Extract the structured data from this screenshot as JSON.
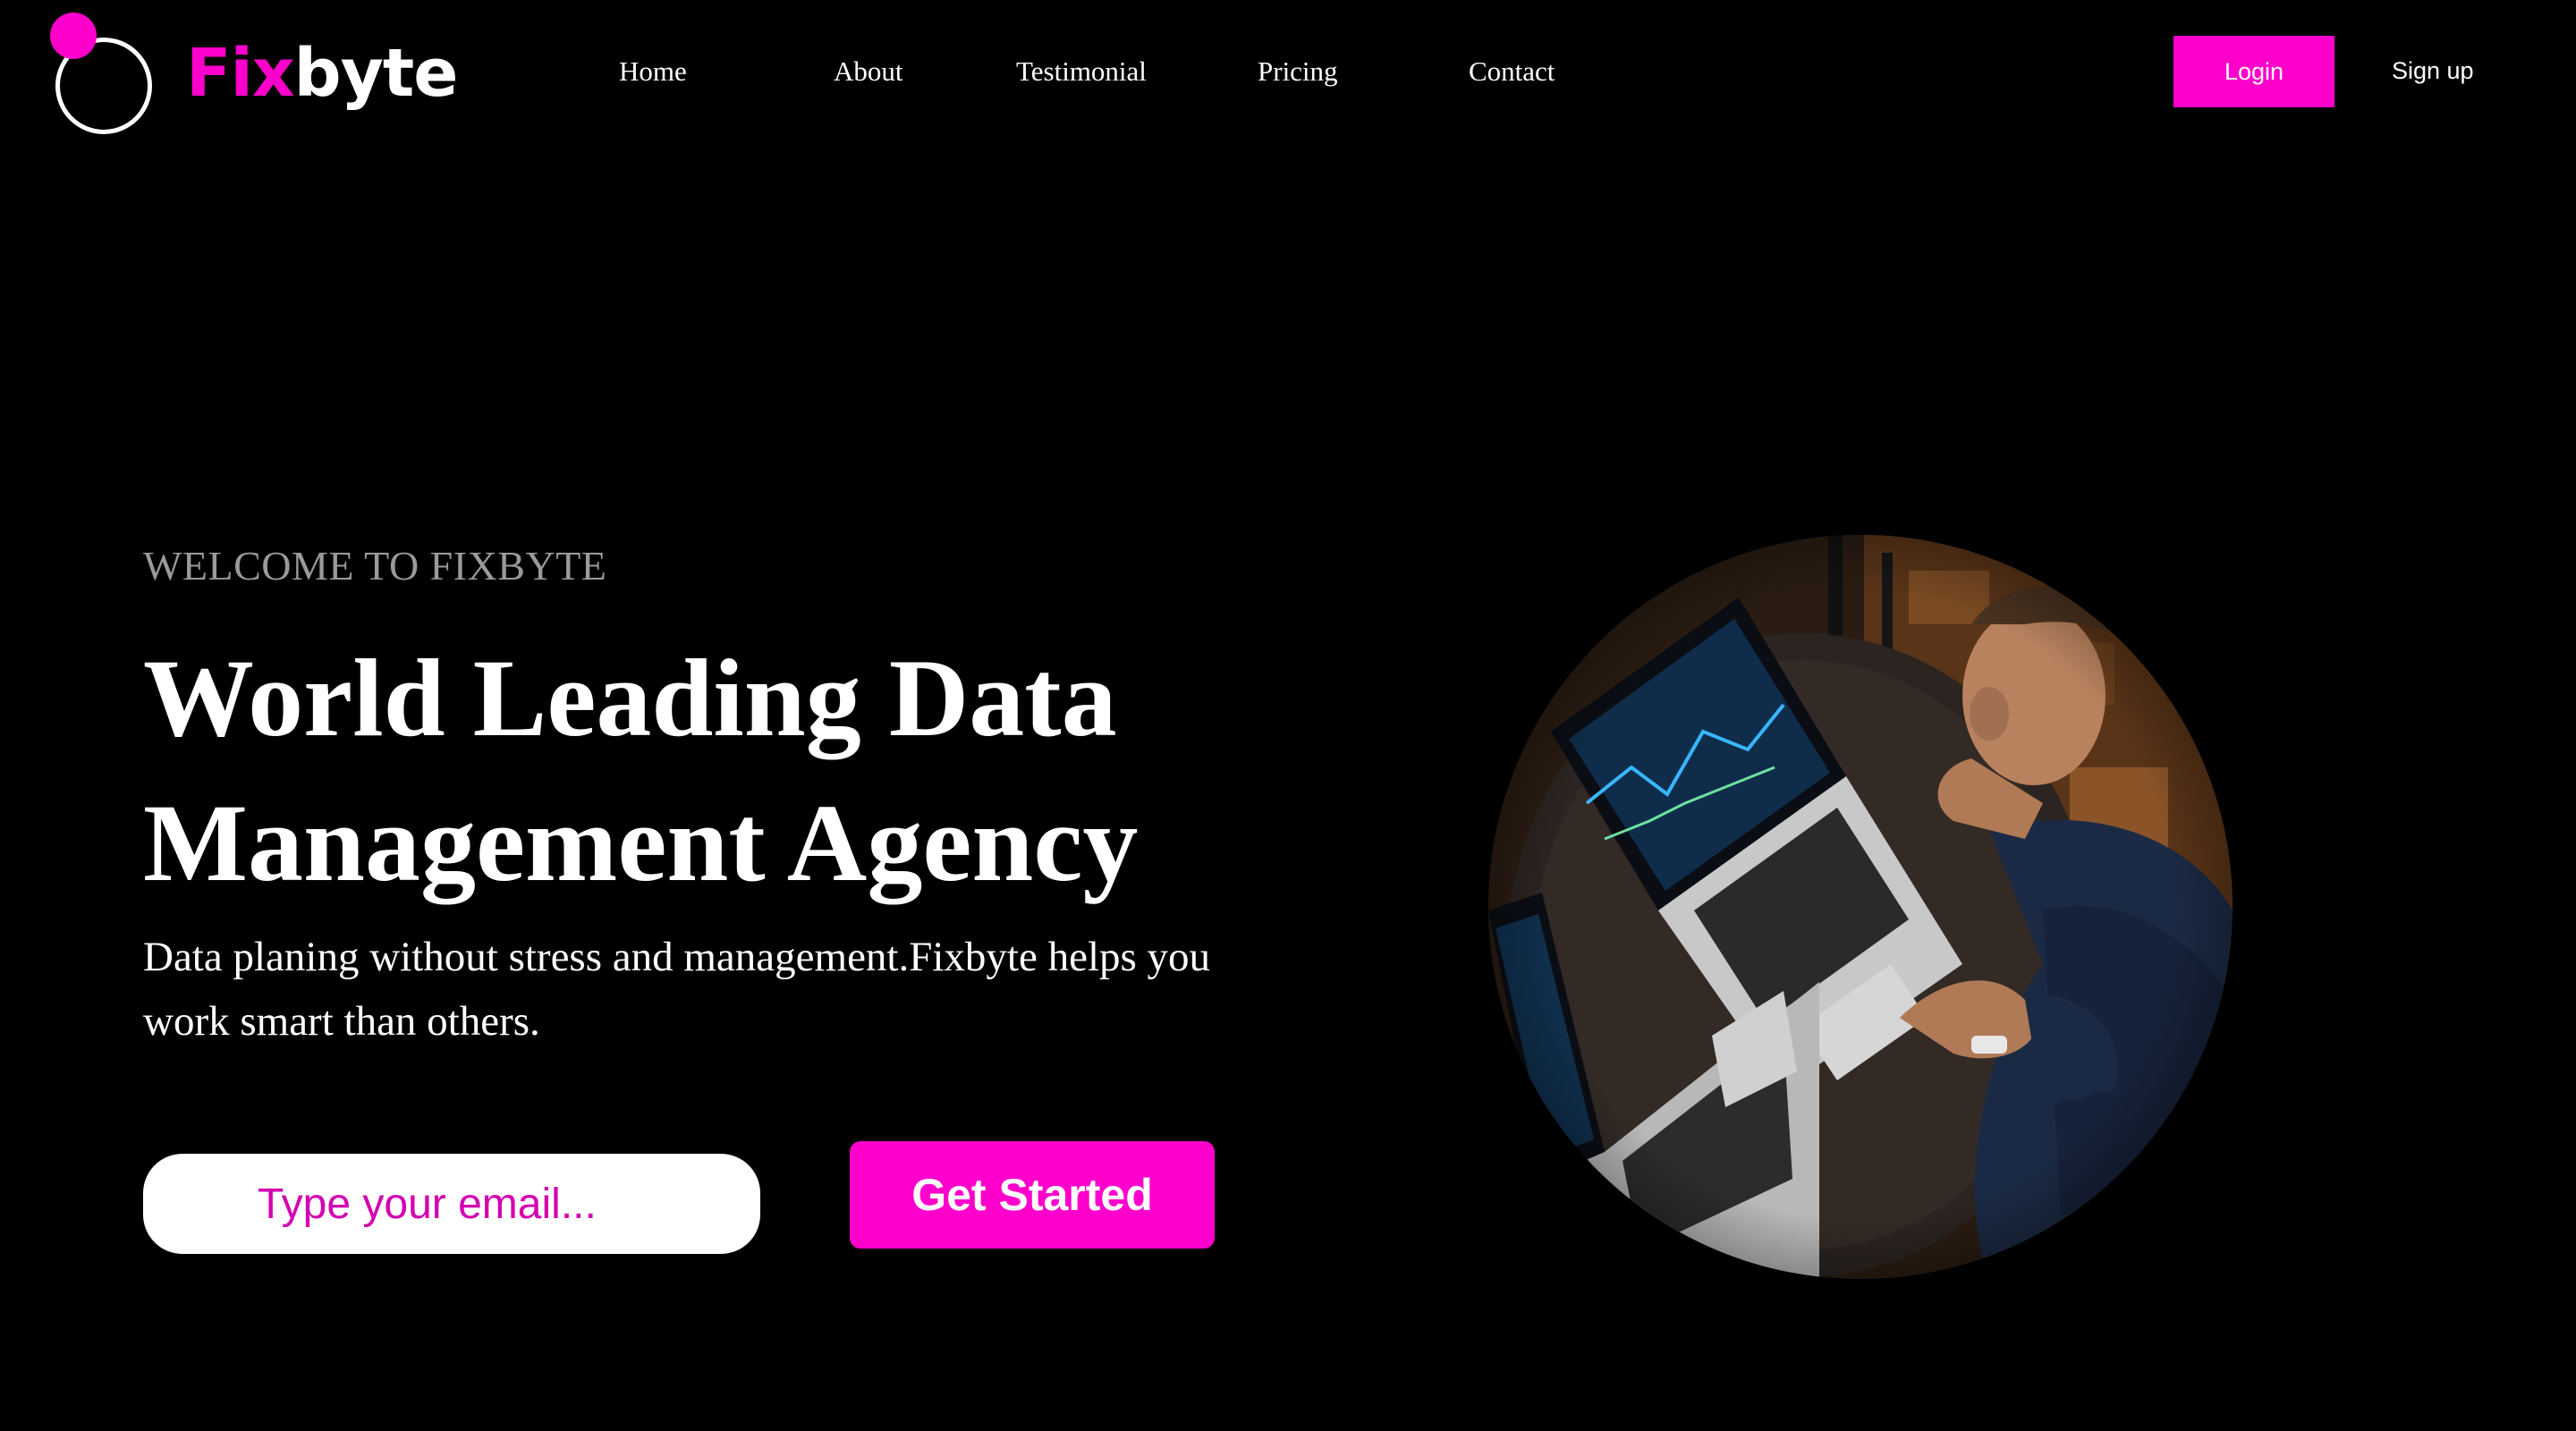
{
  "brand": {
    "name_part1": "Fix",
    "name_part2": "byte",
    "accent_color": "#ff00cc"
  },
  "nav": {
    "items": [
      {
        "label": "Home"
      },
      {
        "label": "About"
      },
      {
        "label": "Testimonial"
      },
      {
        "label": "Pricing"
      },
      {
        "label": "Contact"
      }
    ]
  },
  "auth": {
    "login_label": "Login",
    "signup_label": "Sign up"
  },
  "hero": {
    "eyebrow": "WELCOME TO FIXBYTE",
    "title": "World Leading Data Management Agency",
    "subtitle": "Data planing without stress and management.Fixbyte helps you work smart than others.",
    "email_placeholder": "Type your email...",
    "cta_label": "Get Started",
    "image_icon": "photo-man-with-laptops"
  }
}
